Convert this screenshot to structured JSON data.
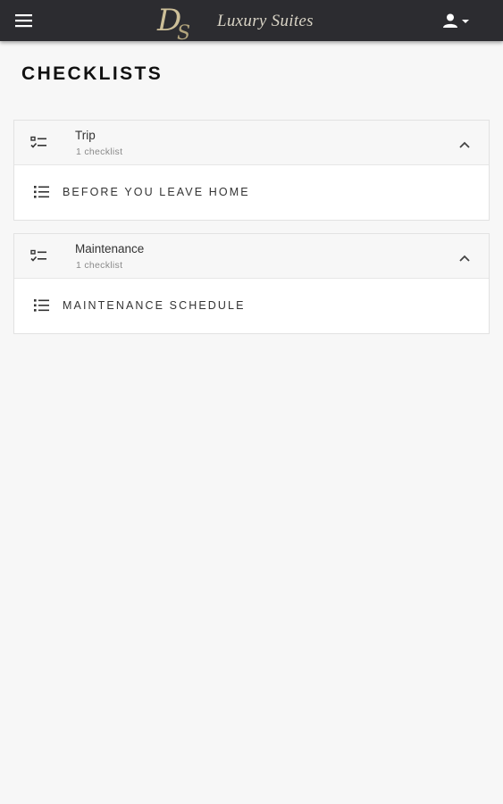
{
  "header": {
    "logo_monogram": "D",
    "logo_monogram_sub": "S",
    "logo_text": "Luxury Suites",
    "menu_icon": "hamburger-menu-icon",
    "user_icon": "user-account-icon",
    "bar_color": "#2c2c30"
  },
  "page": {
    "title": "CHECKLISTS"
  },
  "groups": [
    {
      "name": "Trip",
      "count": "1 checklist",
      "icon": "checklist-group-icon",
      "expanded": true,
      "items": [
        {
          "label": "BEFORE YOU LEAVE HOME",
          "icon": "list-icon"
        }
      ]
    },
    {
      "name": "Maintenance",
      "count": "1 checklist",
      "icon": "checklist-group-icon",
      "expanded": true,
      "items": [
        {
          "label": "MAINTENANCE SCHEDULE",
          "icon": "list-icon"
        }
      ]
    }
  ]
}
